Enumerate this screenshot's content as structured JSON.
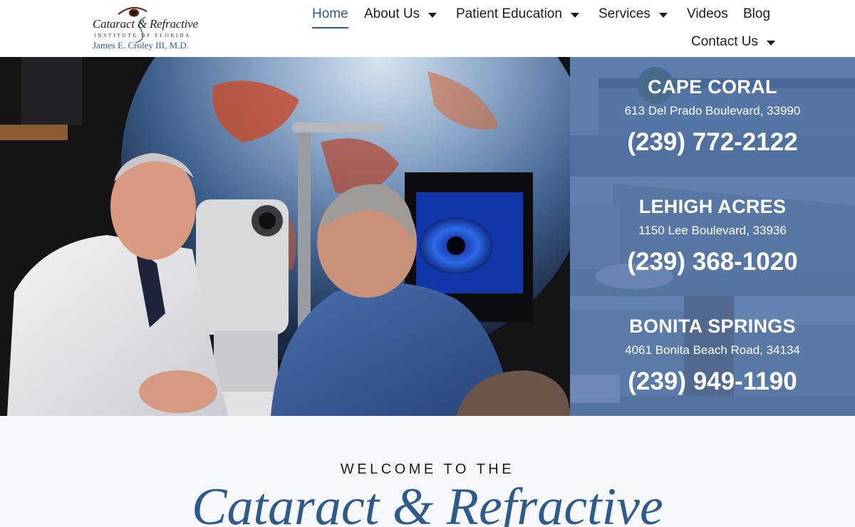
{
  "header": {
    "logo": {
      "line1": "Cataract & Refractive",
      "line2": "INSTITUTE OF FLORIDA",
      "line3": "James E. Croley III, M.D."
    },
    "nav": [
      {
        "label": "Home",
        "active": true,
        "dropdown": false
      },
      {
        "label": "About Us",
        "active": false,
        "dropdown": true
      },
      {
        "label": "Patient Education",
        "active": false,
        "dropdown": true
      },
      {
        "label": "Services",
        "active": false,
        "dropdown": true
      },
      {
        "label": "Videos",
        "active": false,
        "dropdown": false
      },
      {
        "label": "Blog",
        "active": false,
        "dropdown": false
      },
      {
        "label": "Contact Us",
        "active": false,
        "dropdown": true
      }
    ]
  },
  "hero": {
    "image_description": "Doctor in white coat examining a patient at a slit lamp, eye image on monitor in background"
  },
  "locations": [
    {
      "name": "CAPE CORAL",
      "address": "613 Del Prado Boulevard, 33990",
      "phone": "(239) 772-2122"
    },
    {
      "name": "LEHIGH ACRES",
      "address": "1150 Lee Boulevard, 33936",
      "phone": "(239) 368-1020"
    },
    {
      "name": "BONITA SPRINGS",
      "address": "4061 Bonita Beach Road, 34134",
      "phone": "(239) 949-1190"
    }
  ],
  "welcome": {
    "kicker": "WELCOME TO THE",
    "title": "Cataract & Refractive"
  },
  "colors": {
    "brand_blue": "#2f5b8c",
    "location_overlay": "#3a629e",
    "welcome_bg": "#f6f8fc"
  }
}
